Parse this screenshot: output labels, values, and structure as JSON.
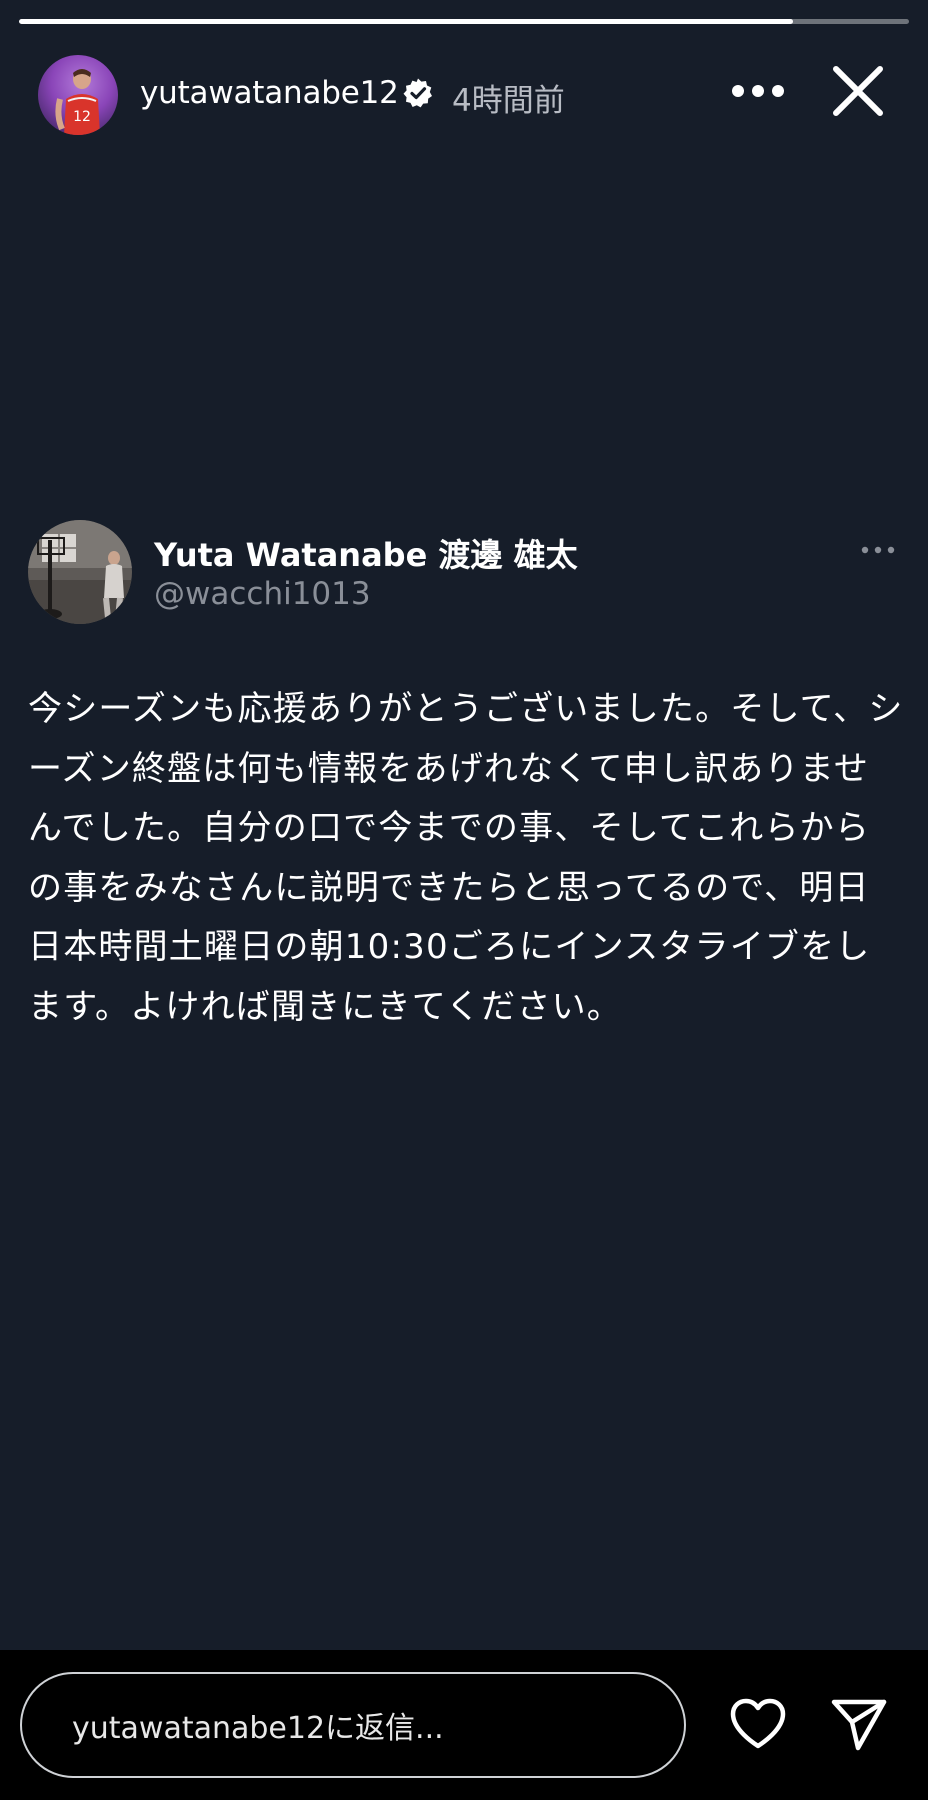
{
  "story": {
    "progress": 0.87,
    "username": "yutawatanabe12",
    "verified_icon": "verified-badge-icon",
    "time_ago": "4時間前",
    "more_icon": "more-horizontal-icon",
    "close_icon": "close-icon"
  },
  "tweet": {
    "display_name": "Yuta Watanabe 渡邊 雄太",
    "handle": "@wacchi1013",
    "more_icon": "more-horizontal-icon",
    "body": "今シーズンも応援ありがとうございました。そして、シーズン終盤は何も情報をあげれなくて申し訳ありませんでした。自分の口で今までの事、そしてこれらからの事をみなさんに説明できたらと思ってるので、明日日本時間土曜日の朝10:30ごろにインスタライブをします。よければ聞きにきてください。"
  },
  "reply": {
    "placeholder": "yutawatanabe12に返信...",
    "heart_icon": "heart-icon",
    "send_icon": "send-icon"
  },
  "colors": {
    "story_background": "#161d29",
    "bottom_bar": "#000000",
    "text_primary": "#ffffff",
    "text_secondary": "#8a8f98"
  }
}
